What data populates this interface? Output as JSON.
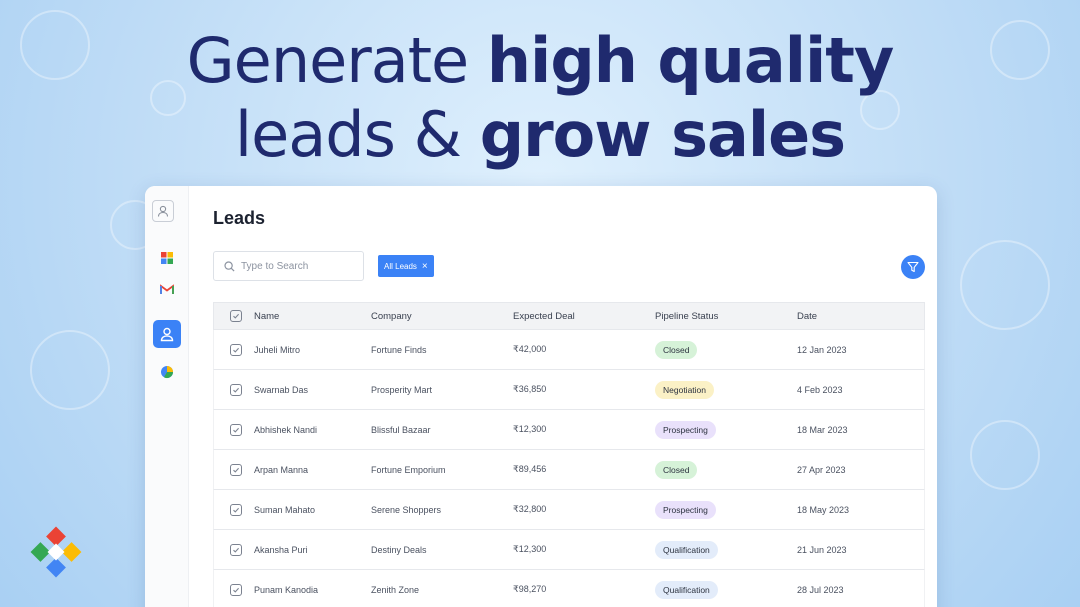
{
  "headline": {
    "line1_light": "Generate ",
    "line1_bold": "high quality",
    "line2_light": "leads & ",
    "line2_bold": "grow sales"
  },
  "sidebar": {
    "items": [
      {
        "icon": "user-icon"
      },
      {
        "icon": "grid-apps-icon"
      },
      {
        "icon": "gmail-icon"
      },
      {
        "icon": "contacts-icon",
        "active": true
      },
      {
        "icon": "pie-chart-icon"
      }
    ]
  },
  "page": {
    "title": "Leads"
  },
  "search": {
    "placeholder": "Type to Search"
  },
  "filter_chip": {
    "label": "All Leads",
    "close": "×"
  },
  "table": {
    "headers": {
      "name": "Name",
      "company": "Company",
      "deal": "Expected Deal",
      "status": "Pipeline Status",
      "date": "Date"
    },
    "rows": [
      {
        "name": "Juheli Mitro",
        "company": "Fortune Finds",
        "deal": "₹42,000",
        "status": "Closed",
        "date": "12 Jan 2023"
      },
      {
        "name": "Swarnab Das",
        "company": "Prosperity Mart",
        "deal": "₹36,850",
        "status": "Negotiation",
        "date": "4 Feb 2023"
      },
      {
        "name": "Abhishek Nandi",
        "company": "Blissful Bazaar",
        "deal": "₹12,300",
        "status": "Prospecting",
        "date": "18 Mar 2023"
      },
      {
        "name": "Arpan Manna",
        "company": "Fortune Emporium",
        "deal": "₹89,456",
        "status": "Closed",
        "date": "27 Apr 2023"
      },
      {
        "name": "Suman Mahato",
        "company": "Serene Shoppers",
        "deal": "₹32,800",
        "status": "Prospecting",
        "date": "18 May 2023"
      },
      {
        "name": "Akansha Puri",
        "company": "Destiny Deals",
        "deal": "₹12,300",
        "status": "Qualification",
        "date": "21 Jun 2023"
      },
      {
        "name": "Punam Kanodia",
        "company": "Zenith Zone",
        "deal": "₹98,270",
        "status": "Qualification",
        "date": "28 Jul 2023"
      }
    ]
  },
  "status_colors": {
    "Closed": "#d6f2d8",
    "Negotiation": "#fbf1c6",
    "Prospecting": "#e9e1fb",
    "Qualification": "#e3ecfa"
  },
  "colors": {
    "accent": "#3b82f6",
    "headline": "#1f2a6e"
  }
}
